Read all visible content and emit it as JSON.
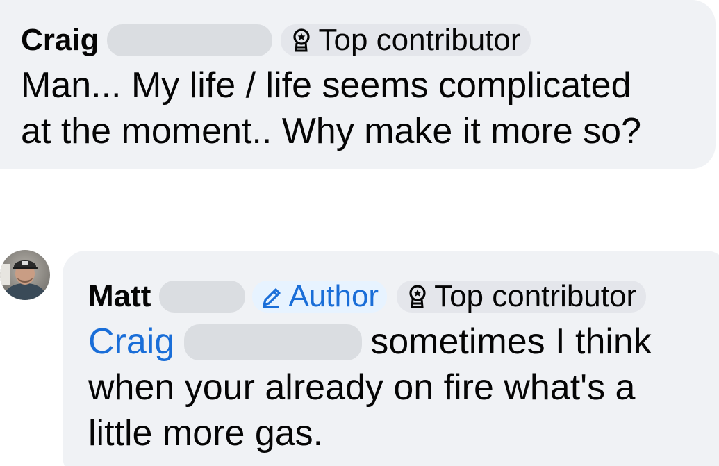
{
  "comments": [
    {
      "author": "Craig",
      "badges": [
        {
          "icon": "award-ribbon-icon",
          "label": "Top contributor"
        }
      ],
      "text_lines": [
        "Man... My life / life seems complicated",
        "at the moment.. Why make it more so?"
      ]
    },
    {
      "author": "Matt",
      "avatar_icon": "profile-photo",
      "badges": [
        {
          "icon": "pencil-icon",
          "label": "Author"
        },
        {
          "icon": "award-ribbon-icon",
          "label": "Top contributor"
        }
      ],
      "mention": "Craig",
      "text_lines": [
        "sometimes I think",
        "when your already on fire what's a",
        "little more gas."
      ]
    }
  ],
  "colors": {
    "bubble": "#f0f2f5",
    "redaction": "#dadde1",
    "link_blue": "#1a6ed8",
    "author_badge_bg": "#e7f3ff"
  }
}
